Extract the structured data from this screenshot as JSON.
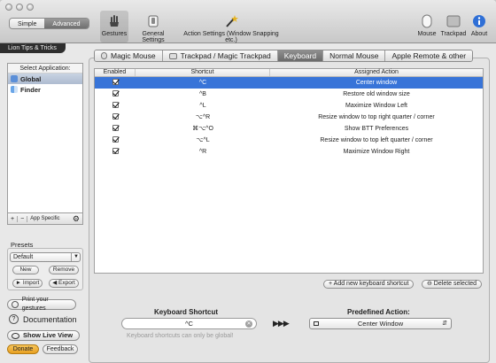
{
  "mode_toggle": {
    "simple": "Simple",
    "advanced": "Advanced"
  },
  "toolbar": {
    "gestures": "Gestures",
    "general_settings": "General Settings",
    "action_settings": "Action Settings (Window Snapping etc.)",
    "mouse": "Mouse",
    "trackpad": "Trackpad",
    "about": "About"
  },
  "lion_tab": "Lion Tips & Tricks",
  "sidebar": {
    "header": "Select Application:",
    "apps": [
      {
        "name": "Global",
        "selected": true
      },
      {
        "name": "Finder",
        "selected": false
      }
    ],
    "footer": {
      "add": "+",
      "remove": "−",
      "app_specific": "App Specific"
    }
  },
  "presets": {
    "label": "Presets",
    "selected": "Default",
    "new": "New",
    "remove": "Remove",
    "import": "Import",
    "export": "Export"
  },
  "side_buttons": {
    "print": "Print your gestures",
    "documentation": "Documentation",
    "live_view": "Show Live View",
    "donate": "Donate",
    "feedback": "Feedback"
  },
  "tabs": [
    "Magic Mouse",
    "Trackpad / Magic Trackpad",
    "Keyboard",
    "Normal Mouse",
    "Apple Remote & other"
  ],
  "selected_tab": 2,
  "table": {
    "headers": [
      "Enabled",
      "Shortcut",
      "Assigned Action"
    ],
    "rows": [
      {
        "enabled": true,
        "shortcut": "^C",
        "action": "Center window",
        "selected": true
      },
      {
        "enabled": true,
        "shortcut": "^B",
        "action": "Restore old window size",
        "selected": false
      },
      {
        "enabled": true,
        "shortcut": "^L",
        "action": "Maximize Window Left",
        "selected": false
      },
      {
        "enabled": true,
        "shortcut": "⌥^R",
        "action": "Resize window to top right quarter / corner",
        "selected": false
      },
      {
        "enabled": true,
        "shortcut": "⌘⌥^O",
        "action": "Show BTT Preferences",
        "selected": false
      },
      {
        "enabled": true,
        "shortcut": "⌥^L",
        "action": "Resize window to top left quarter / corner",
        "selected": false
      },
      {
        "enabled": true,
        "shortcut": "^R",
        "action": "Maximize Window Right",
        "selected": false
      }
    ]
  },
  "table_buttons": {
    "add": "+ Add new keyboard shortcut",
    "delete": "⊖ Delete selected"
  },
  "editor": {
    "shortcut_label": "Keyboard Shortcut",
    "shortcut_value": "^C",
    "note": "Keyboard shortcuts can only be global!",
    "arrows": "▶▶▶",
    "action_label": "Predefined Action:",
    "action_value": "Center Window"
  },
  "colors": {
    "selection": "#3874d8",
    "toolbar_top": "#e9e9e9",
    "donate": "#e8a021"
  }
}
